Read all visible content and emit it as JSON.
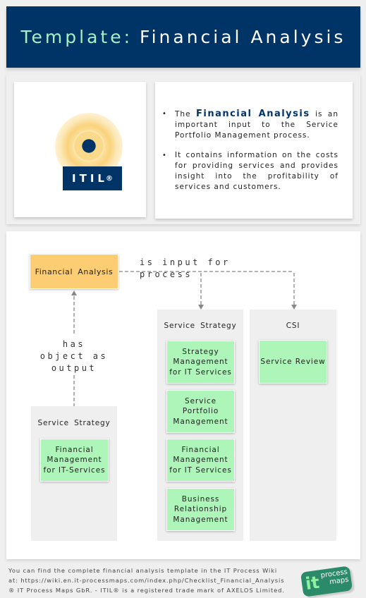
{
  "header": {
    "prefix": "Template:",
    "title": "Financial Analysis"
  },
  "logo": {
    "badge_text": "ITIL",
    "badge_mark": "®"
  },
  "intro": {
    "bullets": [
      {
        "before": "The",
        "highlight": "Financial Analysis",
        "after": "is an important input to the Service Portfolio Management process."
      },
      {
        "text": "It contains information on the costs for providing services and provides insight into the profitability of services and customers."
      }
    ],
    "bullet_glyph": "•"
  },
  "diagram": {
    "object": "Financial Analysis",
    "relation_input": "is input for process",
    "relation_output": [
      "has",
      "object as",
      "output"
    ],
    "lanes": [
      {
        "title": "Service Strategy",
        "processes": [
          "Financial Management for IT-Services"
        ]
      },
      {
        "title": "Service Strategy",
        "processes": [
          "Strategy Management for IT Services",
          "Service Portfolio Management",
          "Financial Management for IT Services",
          "Business Relationship Management"
        ]
      },
      {
        "title": "CSI",
        "processes": [
          "Service Review"
        ]
      }
    ],
    "colors": {
      "object": "#fdcd74",
      "process": "#adf5b8",
      "lane": "#efefef",
      "connector": "#888888"
    }
  },
  "footer": {
    "lines": [
      "You can find the complete financial analysis template in the IT Process Wiki",
      "at: https://wiki.en.it-processmaps.com/index.php/Checklist_Financial_Analysis",
      "® IT Process Maps GbR. - ITIL® is a registered trade mark of AXELOS Limited."
    ],
    "brand_it": "it",
    "brand_process": "process",
    "brand_maps": "maps"
  },
  "theme": {
    "header_bg": "#003366",
    "header_prefix": "#a6f0c2"
  }
}
